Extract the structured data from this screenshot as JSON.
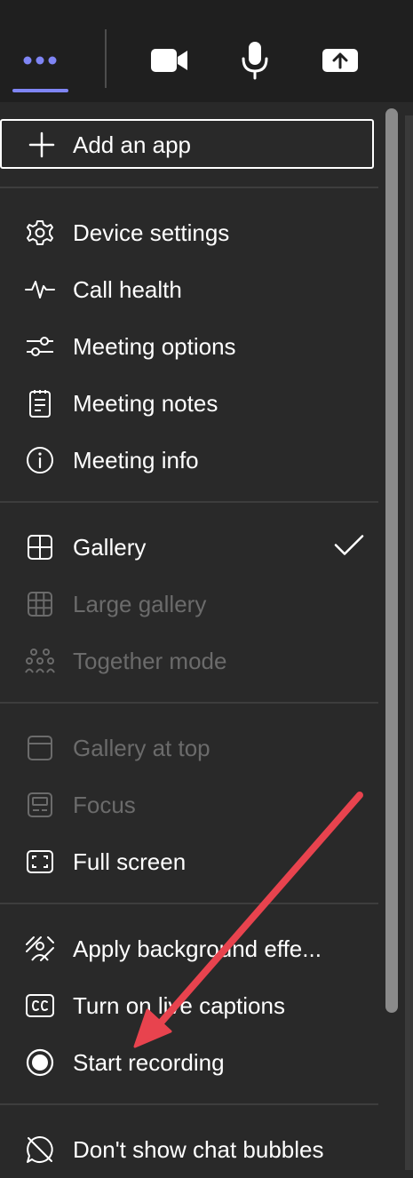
{
  "toolbar": {
    "more_icon": "more-horizontal-icon",
    "camera_icon": "video-camera-icon",
    "mic_icon": "microphone-icon",
    "share_icon": "share-screen-icon",
    "accent_color": "#7f85f5"
  },
  "menu": {
    "add_app": "Add an app",
    "device_settings": "Device settings",
    "call_health": "Call health",
    "meeting_options": "Meeting options",
    "meeting_notes": "Meeting notes",
    "meeting_info": "Meeting info",
    "gallery": "Gallery",
    "large_gallery": "Large gallery",
    "together_mode": "Together mode",
    "gallery_at_top": "Gallery at top",
    "focus": "Focus",
    "full_screen": "Full screen",
    "apply_background": "Apply background effe...",
    "live_captions": "Turn on live captions",
    "start_recording": "Start recording",
    "chat_bubbles": "Don't show chat bubbles"
  },
  "annotation": {
    "arrow_color": "#e8434e"
  }
}
